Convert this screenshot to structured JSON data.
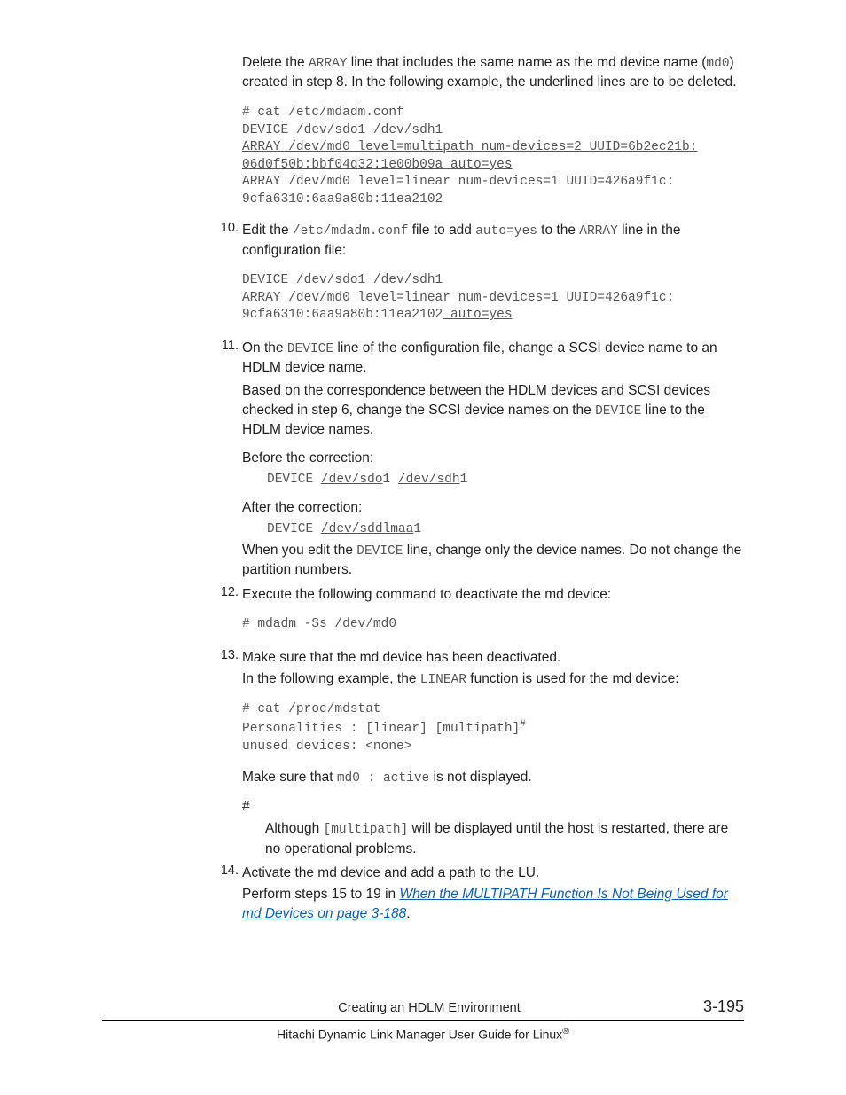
{
  "intro": {
    "p1a": "Delete the ",
    "p1b": " line that includes the same name as the md device name (",
    "p1c": ") created in step 8. In the following example, the underlined lines are to be deleted.",
    "code_array": "ARRAY",
    "code_md0": "md0",
    "block1_l1": "# cat /etc/mdadm.conf",
    "block1_l2": "DEVICE /dev/sdo1 /dev/sdh1",
    "block1_l3": "ARRAY /dev/md0 level=multipath num-devices=2 UUID=6b2ec21b:",
    "block1_l4": "06d0f50b:bbf04d32:1e00b09a auto=yes",
    "block1_l5": "ARRAY /dev/md0 level=linear num-devices=1 UUID=426a9f1c:",
    "block1_l6": "9cfa6310:6aa9a80b:11ea2102"
  },
  "s10": {
    "num": "10.",
    "t1": "Edit the ",
    "c1": "/etc/mdadm.conf",
    "t2": " file to add ",
    "c2": "auto=yes",
    "t3": " to the ",
    "c3": "ARRAY",
    "t4": " line in the configuration file:",
    "block_l1": "DEVICE /dev/sdo1 /dev/sdh1",
    "block_l2": "ARRAY /dev/md0 level=linear num-devices=1 UUID=426a9f1c:",
    "block_l3a": "9cfa6310:6aa9a80b:11ea2102",
    "block_l3b": " auto=yes"
  },
  "s11": {
    "num": "11.",
    "t1": "On the ",
    "c1": "DEVICE",
    "t2": " line of the configuration file, change a SCSI device name to an HDLM device name.",
    "p2a": "Based on the correspondence between the HDLM devices and SCSI devices checked in step 6, change the SCSI device names on the ",
    "p2b": " line to the HDLM device names.",
    "c2": "DEVICE",
    "before_label": "Before the correction:",
    "before_pref": "DEVICE ",
    "before_u1": "/dev/sdo",
    "before_m1": "1 ",
    "before_u2": "/dev/sdh",
    "before_m2": "1",
    "after_label": "After the correction:",
    "after_pref": "DEVICE ",
    "after_u": "/dev/sddlmaa",
    "after_suf": "1",
    "p3a": "When you edit the ",
    "c3": "DEVICE",
    "p3b": " line, change only the device names. Do not change the partition numbers."
  },
  "s12": {
    "num": "12.",
    "t": "Execute the following command to deactivate the md device:",
    "block": "# mdadm -Ss /dev/md0"
  },
  "s13": {
    "num": "13.",
    "t1": "Make sure that the md device has been deactivated.",
    "t2a": "In the following example, the ",
    "c2": "LINEAR",
    "t2b": " function is used for the md device:",
    "block_l1": "# cat /proc/mdstat",
    "block_l2a": "Personalities : [linear] [multipath]",
    "block_l2sup": "#",
    "block_l3": "unused devices: <none>",
    "t3a": "Make sure that ",
    "c3": "md0 : active",
    "t3b": " is not displayed.",
    "hash": "#",
    "fn1": "Although ",
    "fnc": "[multipath]",
    "fn2": " will be displayed until the host is restarted, there are no operational problems."
  },
  "s14": {
    "num": "14.",
    "t1": "Activate the md device and add a path to the LU.",
    "t2": "Perform steps 15 to 19 in ",
    "link": "When the MULTIPATH Function Is Not Being Used for md Devices on page 3-188",
    "t3": "."
  },
  "footer": {
    "center": "Creating an HDLM Environment",
    "page": "3-195",
    "bottom": "Hitachi Dynamic Link Manager User Guide for Linux",
    "reg": "®"
  }
}
